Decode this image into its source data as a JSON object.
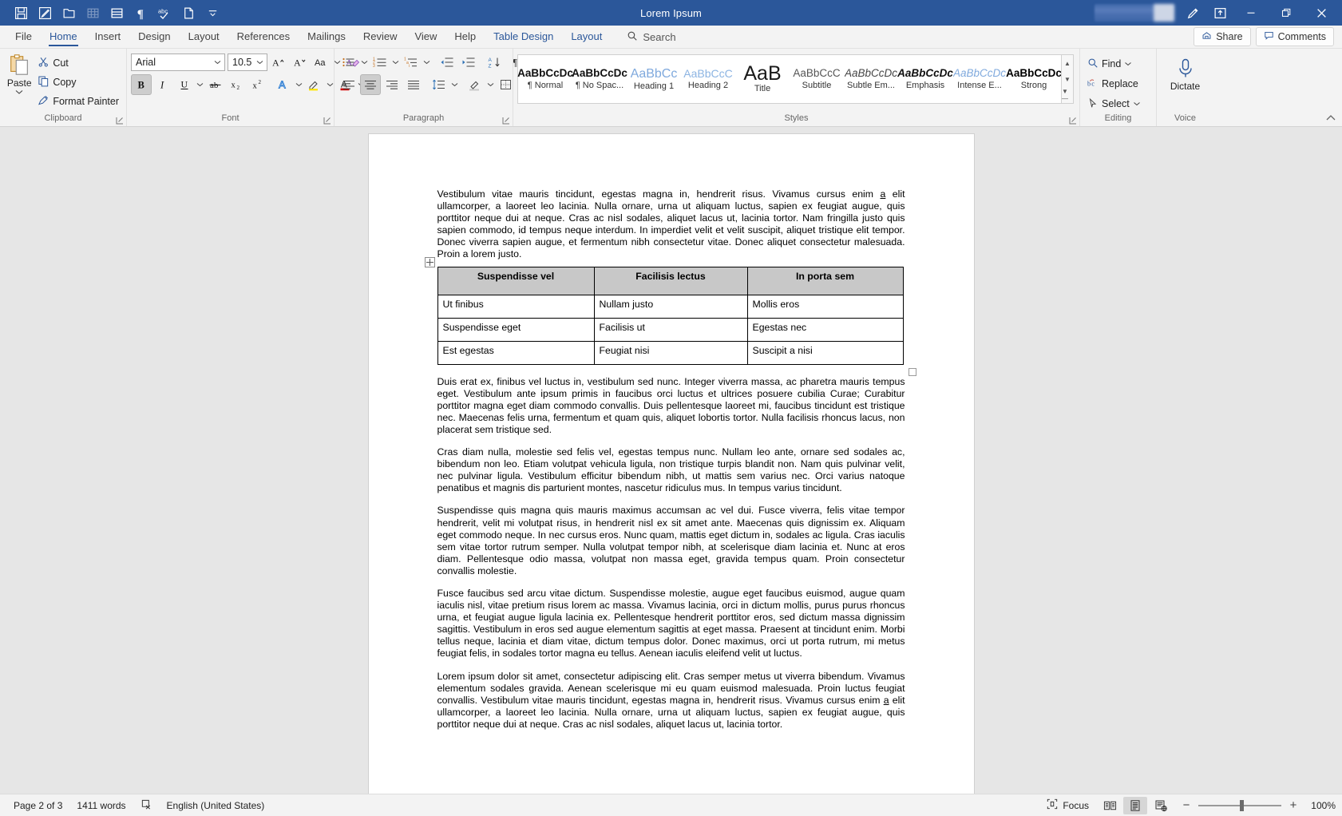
{
  "titlebar": {
    "document_title": "Lorem Ipsum",
    "quick_access": [
      {
        "name": "save-icon",
        "label": "Save"
      },
      {
        "name": "track-changes-icon",
        "label": "Track Changes"
      },
      {
        "name": "open-folder-icon",
        "label": "Open"
      },
      {
        "name": "insert-table-icon",
        "label": "Insert Table"
      },
      {
        "name": "print-layout-icon",
        "label": "Print Layout"
      },
      {
        "name": "pilcrow-icon",
        "label": "Show Formatting Marks"
      },
      {
        "name": "spelling-check-icon",
        "label": "Spelling & Grammar"
      },
      {
        "name": "new-document-icon",
        "label": "New Document"
      },
      {
        "name": "customize-qat-icon",
        "label": "Customize Quick Access Toolbar"
      }
    ],
    "window_controls": {
      "pen_label": "Drawing",
      "ribbon_display_label": "Ribbon Display Options",
      "minimize_label": "Minimize",
      "restore_label": "Restore Down",
      "close_label": "Close"
    }
  },
  "tabs": [
    {
      "label": "File",
      "active": false,
      "contextual": false
    },
    {
      "label": "Home",
      "active": true,
      "contextual": false
    },
    {
      "label": "Insert",
      "active": false,
      "contextual": false
    },
    {
      "label": "Design",
      "active": false,
      "contextual": false
    },
    {
      "label": "Layout",
      "active": false,
      "contextual": false
    },
    {
      "label": "References",
      "active": false,
      "contextual": false
    },
    {
      "label": "Mailings",
      "active": false,
      "contextual": false
    },
    {
      "label": "Review",
      "active": false,
      "contextual": false
    },
    {
      "label": "View",
      "active": false,
      "contextual": false
    },
    {
      "label": "Help",
      "active": false,
      "contextual": false
    },
    {
      "label": "Table Design",
      "active": false,
      "contextual": true
    },
    {
      "label": "Layout",
      "active": false,
      "contextual": true
    }
  ],
  "search": {
    "placeholder": "Search",
    "label": "Search"
  },
  "strip_right": {
    "share_label": "Share",
    "comments_label": "Comments"
  },
  "ribbon": {
    "clipboard": {
      "group_label": "Clipboard",
      "paste_label": "Paste",
      "cut_label": "Cut",
      "copy_label": "Copy",
      "format_painter_label": "Format Painter"
    },
    "font": {
      "group_label": "Font",
      "font_name": "Arial",
      "font_size": "10.5",
      "grow_font_label": "Increase Font Size",
      "shrink_font_label": "Decrease Font Size",
      "change_case_label": "Change Case",
      "clear_formatting_label": "Clear All Formatting",
      "bold_label": "Bold",
      "bold_active": true,
      "italic_label": "Italic",
      "underline_label": "Underline",
      "strikethrough_label": "Strikethrough",
      "subscript_label": "Subscript",
      "superscript_label": "Superscript",
      "text_effects_label": "Text Effects and Typography",
      "highlight_label": "Text Highlight Color",
      "font_color_label": "Font Color"
    },
    "paragraph": {
      "group_label": "Paragraph",
      "bullets_label": "Bullets",
      "numbering_label": "Numbering",
      "multilevel_label": "Multilevel List",
      "decrease_indent_label": "Decrease Indent",
      "increase_indent_label": "Increase Indent",
      "sort_label": "Sort",
      "show_marks_label": "Show/Hide Formatting Marks",
      "align_left_label": "Align Left",
      "align_center_label": "Center",
      "align_center_active": true,
      "align_right_label": "Align Right",
      "justify_label": "Justify",
      "line_spacing_label": "Line and Paragraph Spacing",
      "shading_label": "Shading",
      "borders_label": "Borders"
    },
    "styles": {
      "group_label": "Styles",
      "items": [
        {
          "preview": "AaBbCcDc",
          "name": "¶ Normal",
          "kind": "normal"
        },
        {
          "preview": "AaBbCcDc",
          "name": "¶ No Spac...",
          "kind": "normal"
        },
        {
          "preview": "AaBbCc",
          "name": "Heading 1",
          "kind": "heading"
        },
        {
          "preview": "AaBbCcC",
          "name": "Heading 2",
          "kind": "heading"
        },
        {
          "preview": "AaB",
          "name": "Title",
          "kind": "title"
        },
        {
          "preview": "AaBbCcC",
          "name": "Subtitle",
          "kind": "subtitle"
        },
        {
          "preview": "AaBbCcDc",
          "name": "Subtle Em...",
          "kind": "subtle-em"
        },
        {
          "preview": "AaBbCcDc",
          "name": "Emphasis",
          "kind": "emphasis"
        },
        {
          "preview": "AaBbCcDc",
          "name": "Intense E...",
          "kind": "intense-em"
        },
        {
          "preview": "AaBbCcDc",
          "name": "Strong",
          "kind": "strong"
        }
      ]
    },
    "editing": {
      "group_label": "Editing",
      "find_label": "Find",
      "replace_label": "Replace",
      "select_label": "Select"
    },
    "voice": {
      "group_label": "Voice",
      "dictate_label": "Dictate"
    },
    "collapse_label": "Collapse the Ribbon"
  },
  "document": {
    "paragraphs_before_table": [
      "Vestibulum vitae mauris tincidunt, egestas magna in, hendrerit risus. Vivamus cursus enim a elit ullamcorper, a laoreet leo lacinia. Nulla ornare, urna ut aliquam luctus, sapien ex feugiat augue, quis porttitor neque dui at neque. Cras ac nisl sodales, aliquet lacus ut, lacinia tortor. Nam fringilla justo quis sapien commodo, id tempus neque interdum. In imperdiet velit et velit suscipit, aliquet tristique elit tempor. Donec viverra sapien augue, et fermentum nibh consectetur vitae. Donec aliquet consectetur malesuada. Proin a lorem justo."
    ],
    "table": {
      "headers": [
        "Suspendisse vel",
        "Facilisis lectus",
        "In porta sem"
      ],
      "rows": [
        [
          "Ut finibus",
          "Nullam justo",
          "Mollis eros"
        ],
        [
          "Suspendisse eget",
          "Facilisis ut",
          "Egestas nec"
        ],
        [
          "Est egestas",
          "Feugiat nisi",
          "Suscipit a nisi"
        ]
      ],
      "move_handle_label": "Table Move Handle",
      "resize_handle_label": "Table Resize Handle"
    },
    "paragraphs_after_table": [
      "Duis erat ex, finibus vel luctus in, vestibulum sed nunc. Integer viverra massa, ac pharetra mauris tempus eget. Vestibulum ante ipsum primis in faucibus orci luctus et ultrices posuere cubilia Curae; Curabitur porttitor magna eget diam commodo convallis. Duis pellentesque laoreet mi, faucibus tincidunt est tristique nec. Maecenas felis urna, fermentum et quam quis, aliquet lobortis tortor. Nulla facilisis rhoncus lacus, non placerat sem tristique sed.",
      "Cras diam nulla, molestie sed felis vel, egestas tempus nunc. Nullam leo ante, ornare sed sodales ac, bibendum non leo. Etiam volutpat vehicula ligula, non tristique turpis blandit non. Nam quis pulvinar velit, nec pulvinar ligula. Vestibulum efficitur bibendum nibh, ut mattis sem varius nec. Orci varius natoque penatibus et magnis dis parturient montes, nascetur ridiculus mus. In tempus varius tincidunt.",
      "Suspendisse quis magna quis mauris maximus accumsan ac vel dui. Fusce viverra, felis vitae tempor hendrerit, velit mi volutpat risus, in hendrerit nisl ex sit amet ante. Maecenas quis dignissim ex. Aliquam eget commodo neque. In nec cursus eros. Nunc quam, mattis eget dictum in, sodales ac ligula. Cras iaculis sem vitae tortor rutrum semper. Nulla volutpat tempor nibh, at scelerisque diam lacinia et. Nunc at eros diam. Pellentesque odio massa, volutpat non massa eget, gravida tempus quam. Proin consectetur convallis molestie.",
      "Fusce faucibus sed arcu vitae dictum. Suspendisse molestie, augue eget faucibus euismod, augue quam iaculis nisl, vitae pretium risus lorem ac massa. Vivamus lacinia, orci in dictum mollis, purus purus rhoncus urna, et feugiat augue ligula lacinia ex. Pellentesque hendrerit porttitor eros, sed dictum massa dignissim sagittis. Vestibulum in eros sed augue elementum sagittis at eget massa. Praesent at tincidunt enim. Morbi tellus neque, lacinia et diam vitae, dictum tempus dolor. Donec maximus, orci ut porta rutrum, mi metus feugiat felis, in sodales tortor magna eu tellus. Aenean iaculis eleifend velit ut luctus.",
      "Lorem ipsum dolor sit amet, consectetur adipiscing elit. Cras semper metus ut viverra bibendum. Vivamus elementum sodales gravida. Aenean scelerisque mi eu quam euismod malesuada. Proin luctus feugiat convallis. Vestibulum vitae mauris tincidunt, egestas magna in, hendrerit risus. Vivamus cursus enim a elit ullamcorper, a laoreet leo lacinia. Nulla ornare, urna ut aliquam luctus, sapien ex feugiat augue, quis porttitor neque dui at neque. Cras ac nisl sodales, aliquet lacus ut, lacinia tortor."
    ]
  },
  "statusbar": {
    "page_label": "Page 2 of 3",
    "word_count": "1411 words",
    "proofing_icon_label": "Proofing Errors",
    "language": "English (United States)",
    "focus_label": "Focus",
    "read_mode_label": "Read Mode",
    "print_layout_label": "Print Layout",
    "web_layout_label": "Web Layout",
    "zoom_out_label": "Zoom Out",
    "zoom_in_label": "Zoom In",
    "zoom_level": "100%"
  },
  "colors": {
    "title_bar": "#2b579a",
    "accent": "#2b579a",
    "ribbon_bg": "#f3f3f3",
    "canvas_bg": "#e6e6e6",
    "table_header_fill": "#c8c8c8"
  }
}
